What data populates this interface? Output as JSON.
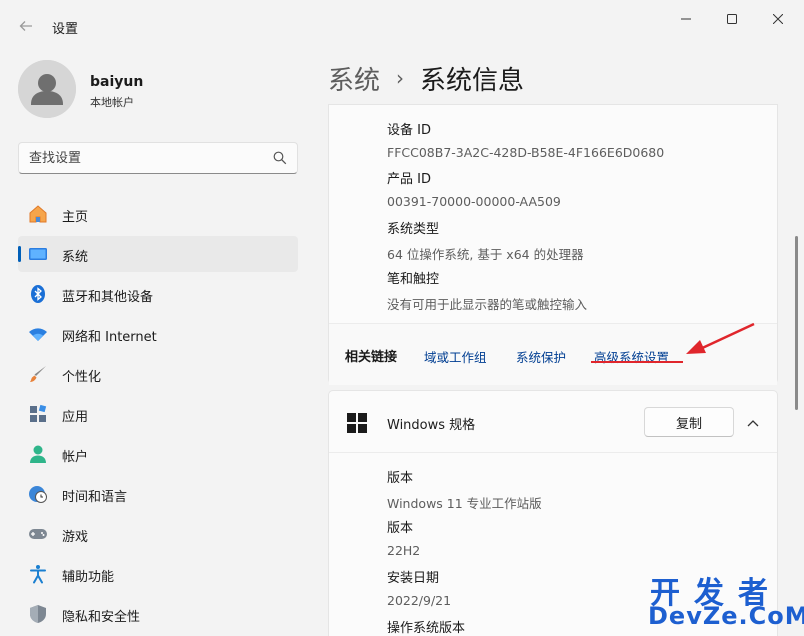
{
  "window": {
    "title": "设置"
  },
  "profile": {
    "name": "baiyun",
    "account_type": "本地帐户"
  },
  "search": {
    "placeholder": "查找设置"
  },
  "sidebar": {
    "items": [
      {
        "label": "主页",
        "icon": "home-icon",
        "active": false
      },
      {
        "label": "系统",
        "icon": "system-icon",
        "active": true
      },
      {
        "label": "蓝牙和其他设备",
        "icon": "bluetooth-icon",
        "active": false
      },
      {
        "label": "网络和 Internet",
        "icon": "wifi-icon",
        "active": false
      },
      {
        "label": "个性化",
        "icon": "brush-icon",
        "active": false
      },
      {
        "label": "应用",
        "icon": "apps-icon",
        "active": false
      },
      {
        "label": "帐户",
        "icon": "account-icon",
        "active": false
      },
      {
        "label": "时间和语言",
        "icon": "globe-clock-icon",
        "active": false
      },
      {
        "label": "游戏",
        "icon": "gamepad-icon",
        "active": false
      },
      {
        "label": "辅助功能",
        "icon": "accessibility-icon",
        "active": false
      },
      {
        "label": "隐私和安全性",
        "icon": "shield-icon",
        "active": false
      }
    ]
  },
  "breadcrumb": {
    "parent": "系统",
    "separator": "›",
    "current": "系统信息"
  },
  "device_info": {
    "device_id_label": "设备 ID",
    "device_id_value": "FFCC08B7-3A2C-428D-B58E-4F166E6D0680",
    "product_id_label": "产品 ID",
    "product_id_value": "00391-70000-00000-AA509",
    "system_type_label": "系统类型",
    "system_type_value": "64 位操作系统, 基于 x64 的处理器",
    "pen_touch_label": "笔和触控",
    "pen_touch_value": "没有可用于此显示器的笔或触控输入"
  },
  "related_links": {
    "label": "相关链接",
    "links": [
      "域或工作组",
      "系统保护",
      "高级系统设置"
    ]
  },
  "windows_spec": {
    "title": "Windows 规格",
    "copy_label": "复制",
    "edition_label": "版本",
    "edition_value": "Windows 11 专业工作站版",
    "version_label": "版本",
    "version_value": "22H2",
    "install_date_label": "安装日期",
    "install_date_value": "2022/9/21",
    "os_build_label": "操作系统版本"
  },
  "watermark": {
    "cn": "开发者",
    "en": "DevZe.CoM"
  },
  "colors": {
    "accent": "#005fb8",
    "link": "#003e92",
    "highlight_red": "#e0262c",
    "watermark": "#1d5fd0"
  }
}
